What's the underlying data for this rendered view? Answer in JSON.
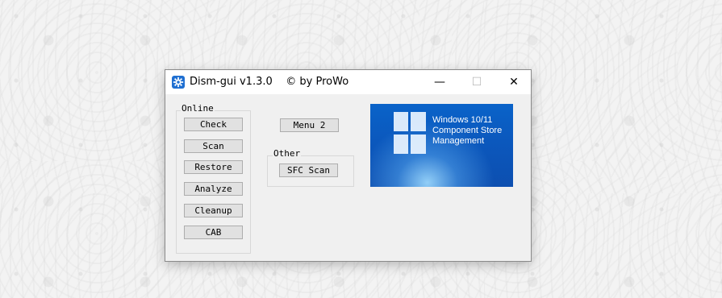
{
  "window": {
    "title": "Dism-gui v1.3.0    © by ProWo",
    "minimize_glyph": "—",
    "maximize_glyph": "☐",
    "close_glyph": "✕"
  },
  "online_group": {
    "label": "Online",
    "buttons": [
      "Check",
      "Scan",
      "Restore",
      "Analyze",
      "Cleanup",
      "CAB"
    ]
  },
  "menu2_button": "Menu 2",
  "other_group": {
    "label": "Other",
    "sfc_button": "SFC Scan"
  },
  "banner": {
    "line1": "Windows 10/11",
    "line2": "Component Store",
    "line3": "Management"
  },
  "icons": [
    "gear-icon",
    "windows-logo-icon"
  ],
  "colors": {
    "banner_blue": "#0b58bd",
    "icon_blue": "#1f6fd1"
  }
}
